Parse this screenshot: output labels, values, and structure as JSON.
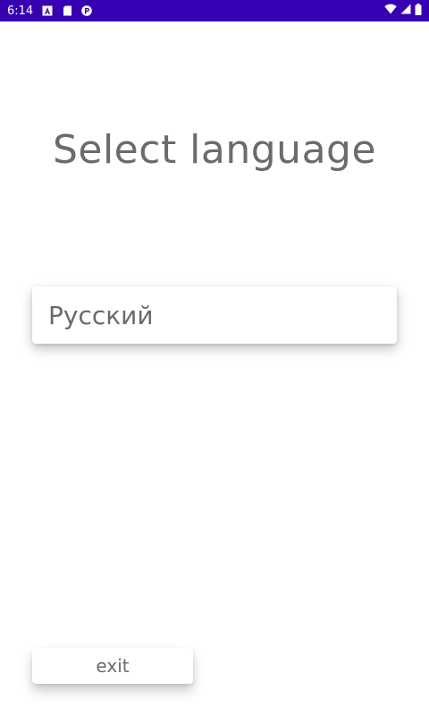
{
  "status_bar": {
    "time": "6:14",
    "background": "#3700b3",
    "notification_icons": [
      "accessibility-a-icon",
      "sd-card-icon",
      "app-badge-icon"
    ],
    "system_icons": [
      "wifi-icon",
      "cellular-signal-icon",
      "battery-icon"
    ]
  },
  "main": {
    "title": "Select language",
    "language_option": "Русский",
    "exit_label": "exit"
  },
  "colors": {
    "text_gray": "#6b6b6b",
    "background": "#ffffff"
  }
}
